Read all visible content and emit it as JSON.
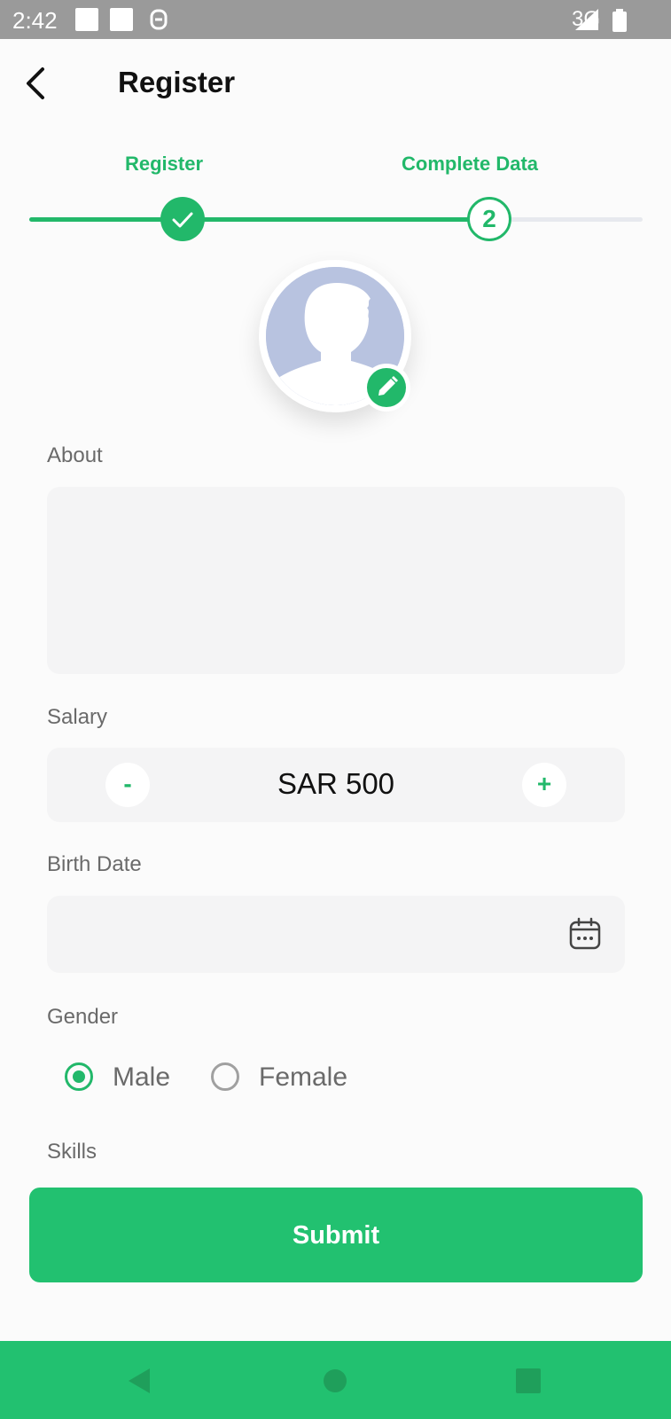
{
  "status_bar": {
    "time": "2:42",
    "network": "3G"
  },
  "header": {
    "title": "Register"
  },
  "stepper": {
    "steps": [
      {
        "label": "Register",
        "state": "done"
      },
      {
        "label": "Complete Data",
        "state": "current",
        "number": "2"
      }
    ],
    "progress": 0.75
  },
  "form": {
    "about": {
      "label": "About",
      "value": ""
    },
    "salary": {
      "label": "Salary",
      "value": "SAR 500",
      "decrement_label": "-",
      "increment_label": "+"
    },
    "birth_date": {
      "label": "Birth Date",
      "value": ""
    },
    "gender": {
      "label": "Gender",
      "options": [
        "Male",
        "Female"
      ],
      "selected": "Male"
    },
    "skills": {
      "label": "Skills"
    }
  },
  "submit_label": "Submit",
  "colors": {
    "accent": "#22c170",
    "label": "#6a6a6a",
    "field_bg": "#f4f4f5"
  }
}
